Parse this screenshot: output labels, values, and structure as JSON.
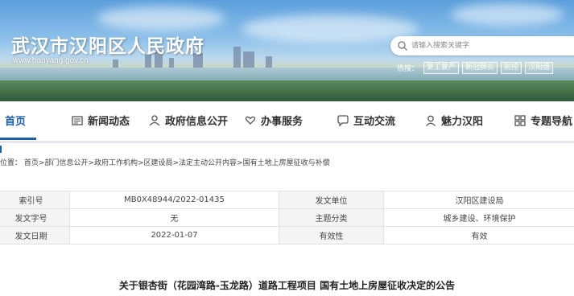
{
  "header": {
    "site_title": "武汉市汉阳区人民政府",
    "site_url": "www.hanyang.gov.cn",
    "search_placeholder": "请输入搜索关键字",
    "hot_label": "热搜：",
    "hot_tags": [
      "复工复产",
      "新冠肺炎",
      "防控",
      "汉阳造"
    ]
  },
  "nav": {
    "items": [
      {
        "label": "首页",
        "icon": "home"
      },
      {
        "label": "新闻动态",
        "icon": "newspaper-icon"
      },
      {
        "label": "政府信息公开",
        "icon": "person-icon"
      },
      {
        "label": "办事服务",
        "icon": "heart-hands-icon"
      },
      {
        "label": "互动交流",
        "icon": "chat-icon"
      },
      {
        "label": "魅力汉阳",
        "icon": "user-icon"
      },
      {
        "label": "专题导航",
        "icon": "grid-icon"
      }
    ]
  },
  "breadcrumb": {
    "text": "位置：  首页>部门信息公开>政府工作机构>区建设局>法定主动公开内容>国有土地上房屋征收与补偿"
  },
  "meta": {
    "rows": [
      {
        "l1": "索引号",
        "v1": "MB0X48944/2022-01435",
        "l2": "发文单位",
        "v2": "汉阳区建设局"
      },
      {
        "l1": "发文字号",
        "v1": "无",
        "l2": "主题分类",
        "v2": "城乡建设、环境保护"
      },
      {
        "l1": "发文日期",
        "v1": "2022-01-07",
        "l2": "有效性",
        "v2": "有效"
      }
    ]
  },
  "document": {
    "title": "关于银杏街（花园湾路-玉龙路）道路工程项目 国有土地上房屋征收决定的公告"
  },
  "colors": {
    "accent": "#1b5fae"
  }
}
